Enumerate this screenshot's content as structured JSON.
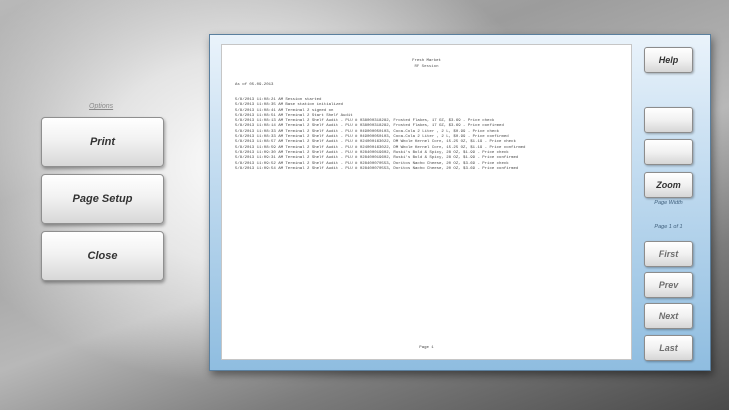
{
  "left_menu": {
    "options_label": "Options",
    "print_label": "Print",
    "page_setup_label": "Page Setup",
    "close_label": "Close"
  },
  "report": {
    "title": "Fresh Market",
    "subtitle": "RF Session",
    "as_of": "As of 05-09-2013",
    "log_lines": [
      "5/8/2013 11:08:21 AM Session started",
      "5/8/2013 11:08:35 AM Base station initialized",
      "5/8/2013 11:08:41 AM Terminal 2 signed on",
      "5/8/2013 11:08:51 AM Terminal 2 Start Shelf Audit",
      "5/8/2013 11:08:13 AM Terminal 2 Shelf Audit - PLU # 038000318282, Frosted Flakes, 17 OZ, $3.69 - Price check",
      "5/8/2013 11:08:14 AM Terminal 2 Shelf Audit - PLU # 038000318282, Frosted Flakes, 17 OZ, $3.69 - Price confirmed",
      "5/8/2013 11:08:33 AM Terminal 2 Shelf Audit - PLU # 049000050103, Coca-Cola 2 Liter , 2 L, $0.99 - Price check",
      "5/8/2013 11:08:33 AM Terminal 2 Shelf Audit - PLU # 049000050103, Coca-Cola 2 Liter , 2 L, $0.99 - Price confirmed",
      "5/8/2013 11:08:57 AM Terminal 2 Shelf Audit - PLU # 024000163022, DM Whole Kernel Corn, 15.25 OZ, $1.19 - Price check",
      "5/8/2013 11:08:59 AM Terminal 2 Shelf Audit - PLU # 024000163022, DM Whole Kernel Corn, 15.25 OZ, $1.19 - Price confirmed",
      "5/8/2013 11:09:30 AM Terminal 2 Shelf Audit - PLU # 028400019602, Ruski's Bold & Spicy, 28 OZ, $1.99 - Price check",
      "5/8/2013 11:09:31 AM Terminal 2 Shelf Audit - PLU # 028400019602, Ruski's Bold & Spicy, 28 OZ, $1.99 - Price confirmed",
      "5/8/2013 11:09:52 AM Terminal 2 Shelf Audit - PLU # 028400070553, Doritos Nacho Cheese, 20 OZ, $3.69 - Price check",
      "5/8/2013 11:09:54 AM Terminal 2 Shelf Audit - PLU # 028400070553, Doritos Nacho Cheese, 20 OZ, $3.69 - Price confirmed"
    ],
    "footer": "Page 1"
  },
  "right_panel": {
    "help_label": "Help",
    "zoom_label": "Zoom",
    "zoom_mode": "Page Width",
    "page_indicator": "Page 1 of 1",
    "first_label": "First",
    "prev_label": "Prev",
    "next_label": "Next",
    "last_label": "Last"
  }
}
